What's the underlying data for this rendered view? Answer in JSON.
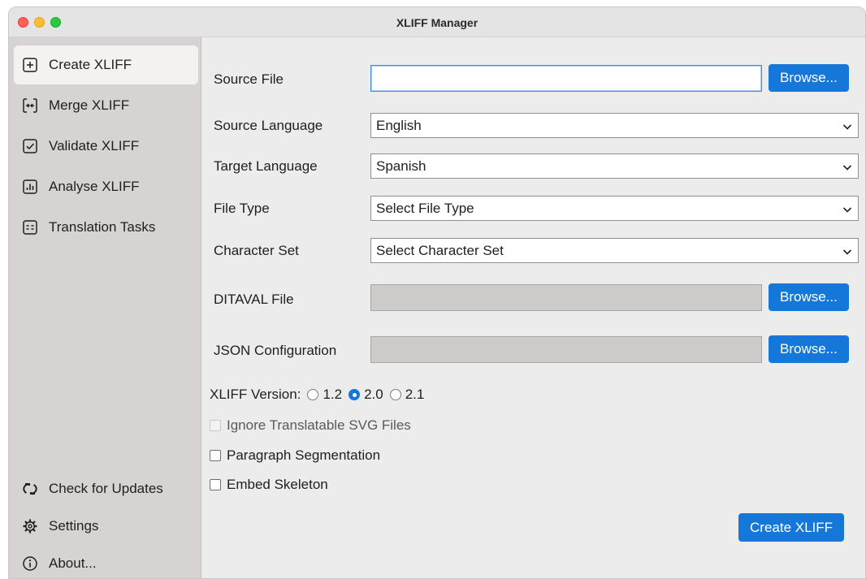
{
  "window": {
    "title": "XLIFF Manager"
  },
  "sidebar": {
    "items": [
      {
        "label": "Create XLIFF",
        "icon": "plus-square-icon"
      },
      {
        "label": "Merge XLIFF",
        "icon": "merge-arrows-icon"
      },
      {
        "label": "Validate XLIFF",
        "icon": "checkbox-icon"
      },
      {
        "label": "Analyse XLIFF",
        "icon": "bar-chart-icon"
      },
      {
        "label": "Translation Tasks",
        "icon": "task-list-icon"
      }
    ],
    "bottom_items": [
      {
        "label": "Check for Updates",
        "icon": "refresh-icon"
      },
      {
        "label": "Settings",
        "icon": "gear-icon"
      },
      {
        "label": "About...",
        "icon": "info-icon"
      }
    ]
  },
  "form": {
    "source_file": {
      "label": "Source File",
      "value": "",
      "button": "Browse..."
    },
    "source_language": {
      "label": "Source Language",
      "selected": "English"
    },
    "target_language": {
      "label": "Target Language",
      "selected": "Spanish"
    },
    "file_type": {
      "label": "File Type",
      "selected": "Select File Type"
    },
    "character_set": {
      "label": "Character Set",
      "selected": "Select Character Set"
    },
    "ditaval_file": {
      "label": "DITAVAL File",
      "value": "",
      "button": "Browse..."
    },
    "json_config": {
      "label": "JSON Configuration",
      "value": "",
      "button": "Browse..."
    },
    "xliff_version": {
      "label": "XLIFF Version:",
      "options": [
        "1.2",
        "2.0",
        "2.1"
      ],
      "selected": "2.0"
    },
    "checkboxes": {
      "ignore_svg": {
        "label": "Ignore Translatable SVG Files",
        "checked": false,
        "disabled": true
      },
      "paragraph_segmentation": {
        "label": "Paragraph Segmentation",
        "checked": false
      },
      "embed_skeleton": {
        "label": "Embed Skeleton",
        "checked": false
      }
    },
    "submit_button": "Create XLIFF"
  },
  "colors": {
    "accent": "#1578d8",
    "sidebar_bg": "#d6d3d2",
    "content_bg": "#ececec"
  }
}
